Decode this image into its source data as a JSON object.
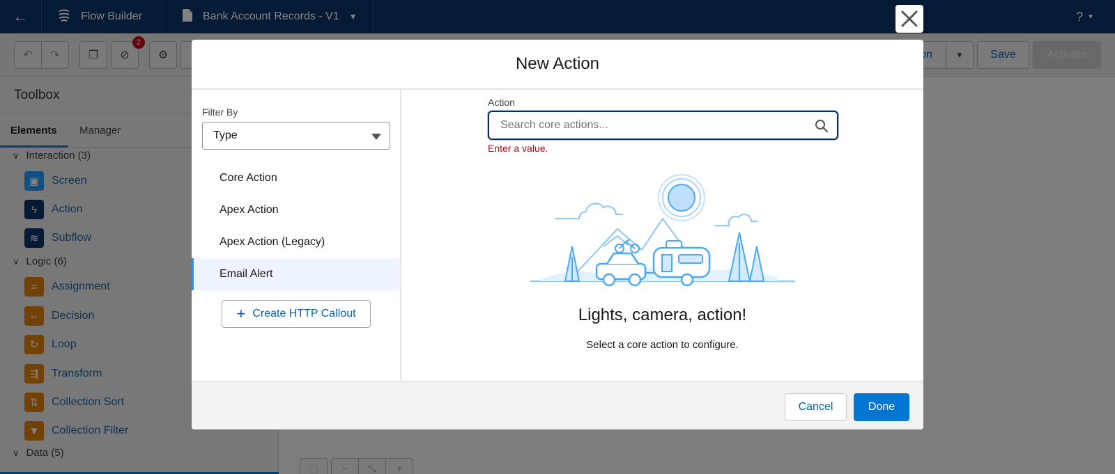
{
  "topbar": {
    "app_name": "Flow Builder",
    "flow_name": "Bank Account Records - V1",
    "help_label": "?"
  },
  "toolbar": {
    "error_count": "2",
    "partial_button_label": "on",
    "save_label": "Save",
    "activate_label": "Activate"
  },
  "toolbox": {
    "title": "Toolbox",
    "tabs": [
      "Elements",
      "Manager"
    ],
    "groups": [
      {
        "label": "Interaction (3)",
        "items": [
          "Screen",
          "Action",
          "Subflow"
        ]
      },
      {
        "label": "Logic (6)",
        "items": [
          "Assignment",
          "Decision",
          "Loop",
          "Transform",
          "Collection Sort",
          "Collection Filter"
        ]
      },
      {
        "label": "Data (5)",
        "items": []
      }
    ]
  },
  "modal": {
    "title": "New Action",
    "filter_label": "Filter By",
    "filter_value": "Type",
    "types": [
      "Core Action",
      "Apex Action",
      "Apex Action (Legacy)",
      "Email Alert"
    ],
    "selected_type": "Email Alert",
    "http_callout_label": "Create HTTP Callout",
    "action_label": "Action",
    "action_placeholder": "Search core actions...",
    "error_text": "Enter a value.",
    "empty_title": "Lights, camera, action!",
    "empty_subtitle": "Select a core action to configure.",
    "cancel_label": "Cancel",
    "done_label": "Done"
  },
  "colors": {
    "nav": "#032d60",
    "brand_blue": "#0176d3",
    "error_red": "#ba0517",
    "logic_orange": "#dd7a01"
  }
}
